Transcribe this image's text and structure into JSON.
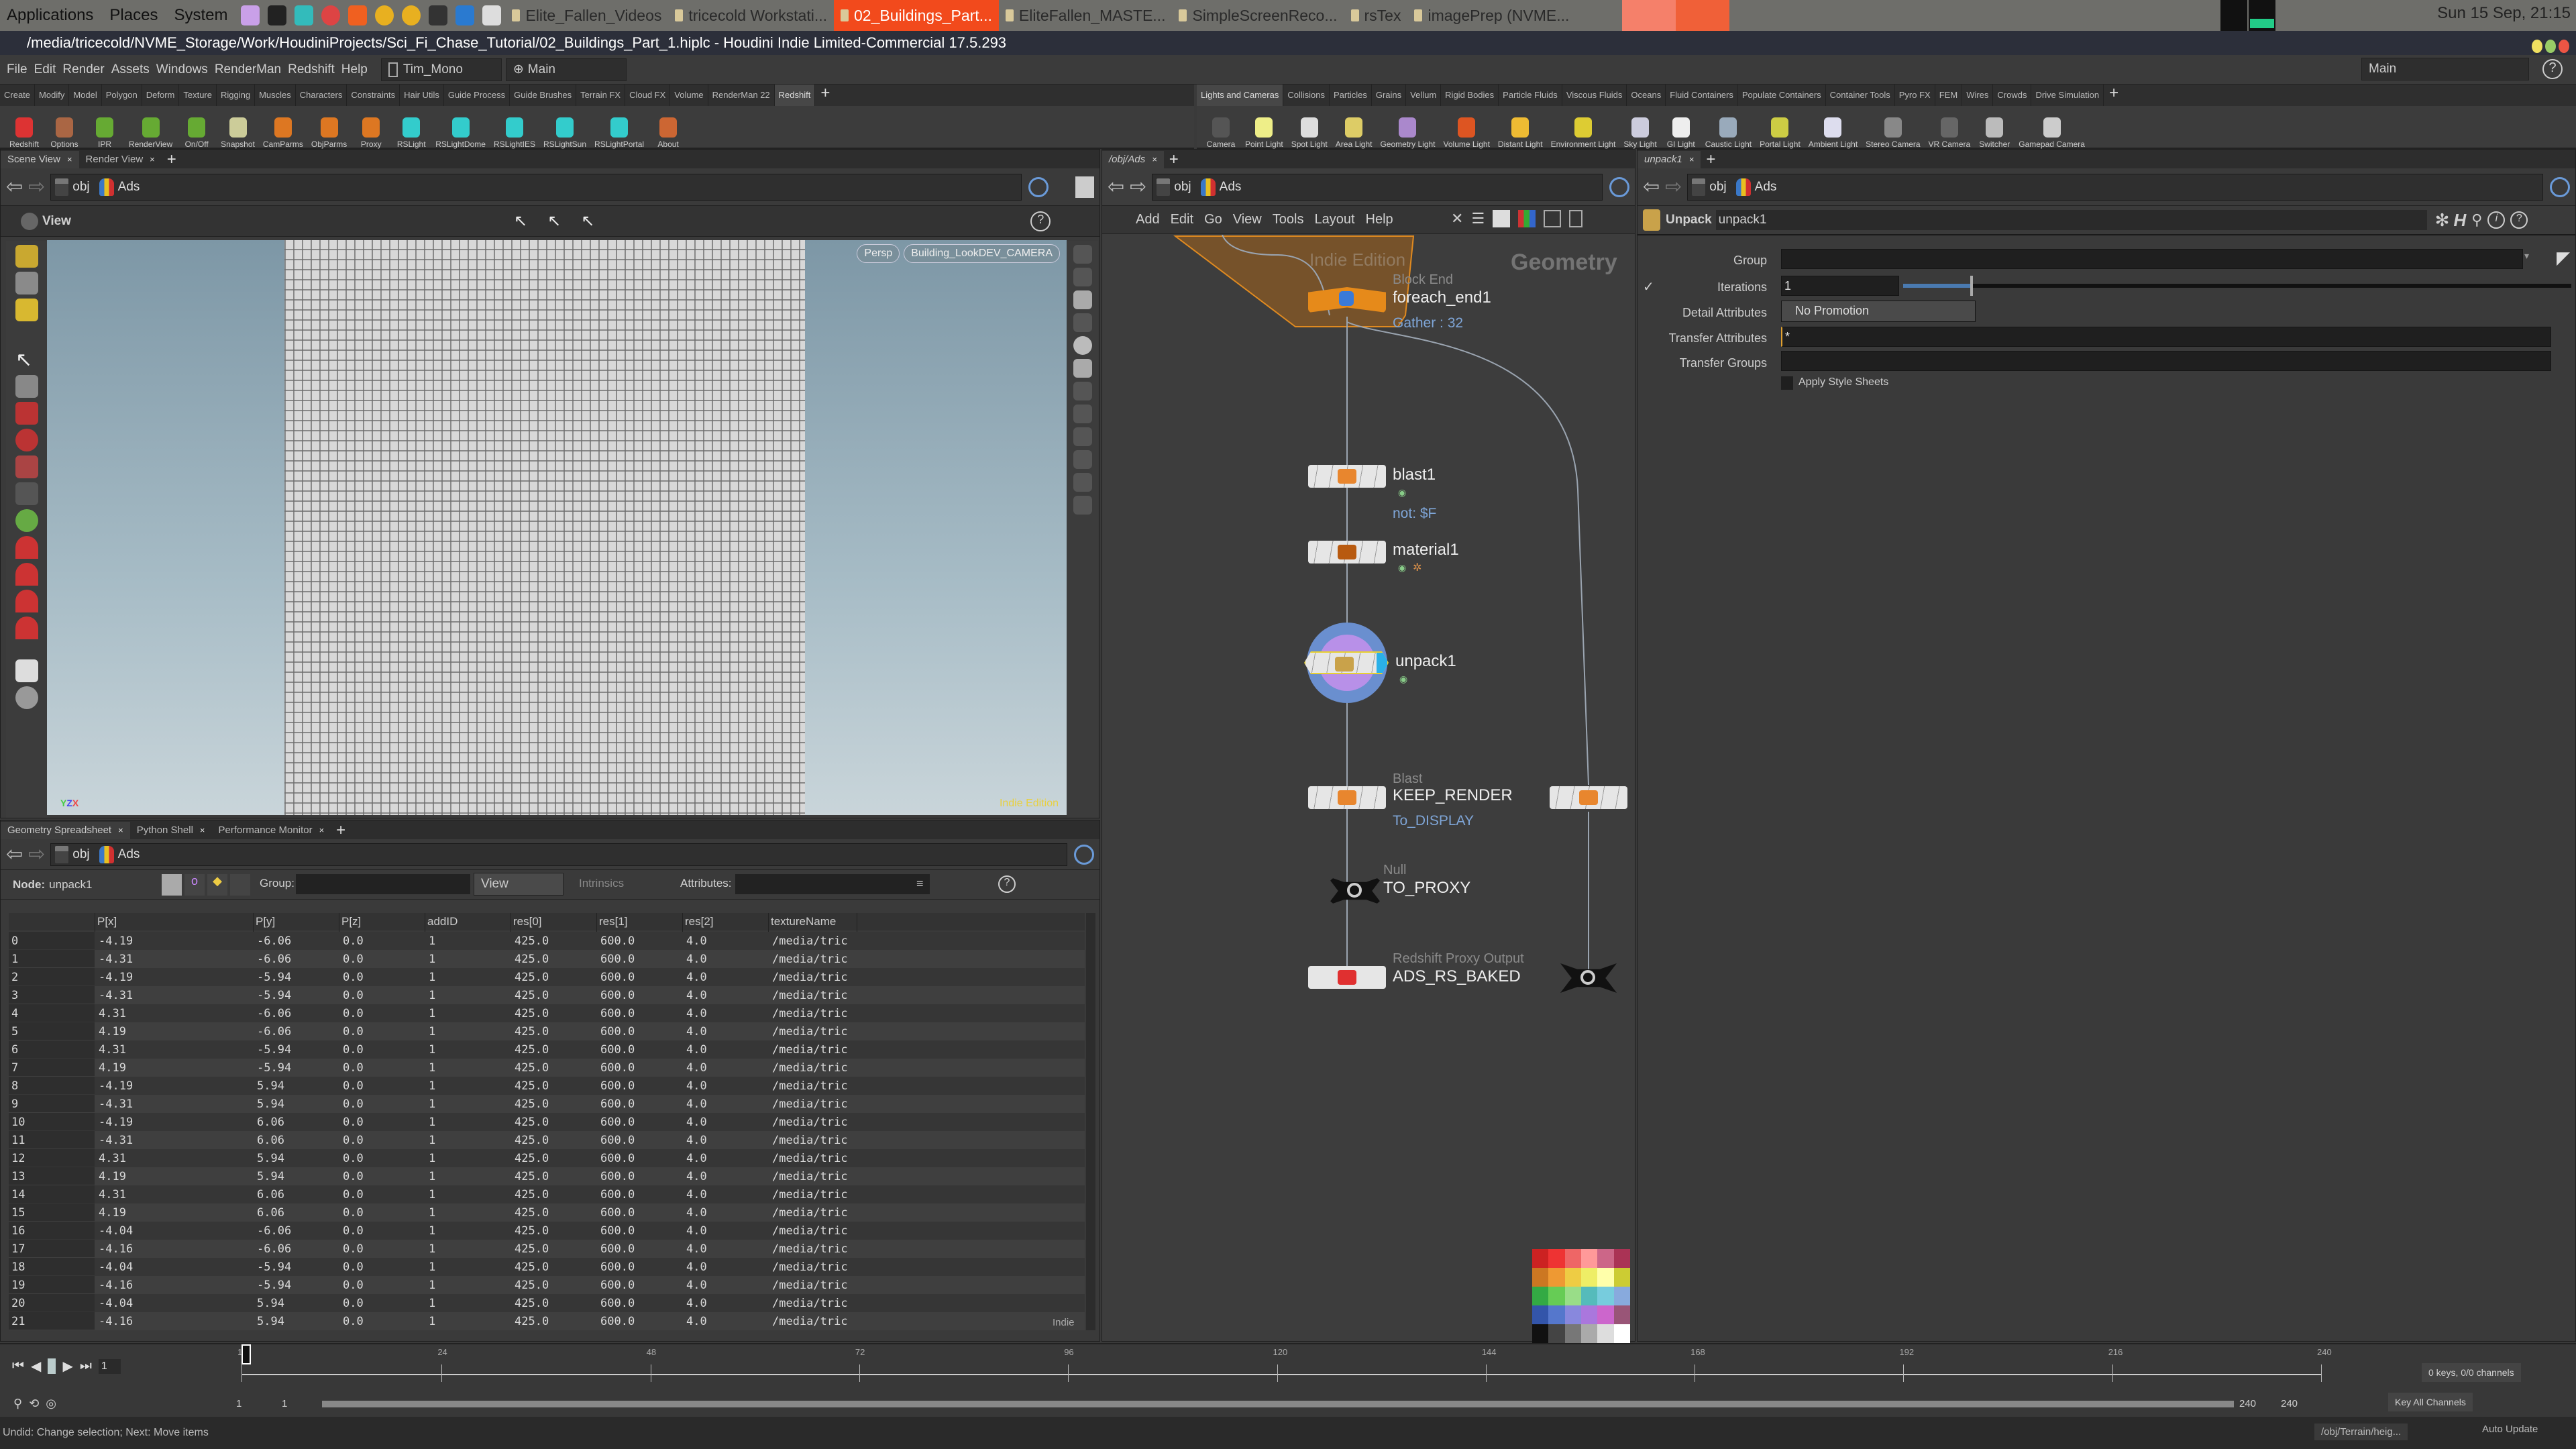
{
  "os": {
    "menus": [
      "Applications",
      "Places",
      "System"
    ],
    "tasks": [
      {
        "label": "Elite_Fallen_Videos",
        "active": false
      },
      {
        "label": "tricecold Workstati...",
        "active": false
      },
      {
        "label": "02_Buildings_Part...",
        "active": true
      },
      {
        "label": "EliteFallen_MASTE...",
        "active": false
      },
      {
        "label": "SimpleScreenReco...",
        "active": false
      },
      {
        "label": "rsTex",
        "active": false
      },
      {
        "label": "imagePrep (NVME...",
        "active": false
      }
    ],
    "clock": "Sun 15 Sep, 21:15"
  },
  "window": {
    "title": "/media/tricecold/NVME_Storage/Work/HoudiniProjects/Sci_Fi_Chase_Tutorial/02_Buildings_Part_1.hiplc - Houdini Indie Limited-Commercial 17.5.293"
  },
  "menubar": {
    "items": [
      "File",
      "Edit",
      "Render",
      "Assets",
      "Windows",
      "RenderMan",
      "Redshift",
      "Help"
    ],
    "desktop": "Tim_Mono",
    "context": "Main",
    "right_context": "Main"
  },
  "shelf_left": {
    "tabs": [
      "Create",
      "Modify",
      "Model",
      "Polygon",
      "Deform",
      "Texture",
      "Rigging",
      "Muscles",
      "Characters",
      "Constraints",
      "Hair Utils",
      "Guide Process",
      "Guide Brushes",
      "Terrain FX",
      "Cloud FX",
      "Volume",
      "RenderMan 22",
      "Redshift"
    ],
    "active_tab": "Redshift",
    "tools": [
      "Redshift",
      "Options",
      "IPR",
      "RenderView",
      "On/Off",
      "Snapshot",
      "CamParms",
      "ObjParms",
      "Proxy",
      "RSLight",
      "RSLightDome",
      "RSLightIES",
      "RSLightSun",
      "RSLightPortal",
      "About"
    ]
  },
  "shelf_right": {
    "tabs": [
      "Lights and Cameras",
      "Collisions",
      "Particles",
      "Grains",
      "Vellum",
      "Rigid Bodies",
      "Particle Fluids",
      "Viscous Fluids",
      "Oceans",
      "Fluid Containers",
      "Populate Containers",
      "Container Tools",
      "Pyro FX",
      "FEM",
      "Wires",
      "Crowds",
      "Drive Simulation"
    ],
    "active_tab": "Lights and Cameras",
    "tools": [
      "Camera",
      "Point Light",
      "Spot Light",
      "Area Light",
      "Geometry Light",
      "Volume Light",
      "Distant Light",
      "Environment Light",
      "Sky Light",
      "GI Light",
      "Caustic Light",
      "Portal Light",
      "Ambient Light",
      "Stereo Camera",
      "VR Camera",
      "Switcher",
      "Gamepad Camera"
    ]
  },
  "scene": {
    "tabs": [
      "Scene View",
      "Render View"
    ],
    "path": [
      "obj",
      "Ads"
    ],
    "toolbar_label": "View",
    "persp": "Persp",
    "camera": "Building_LookDEV_CAMERA",
    "watermark": "Indie Edition"
  },
  "spreadsheet": {
    "tabs": [
      "Geometry Spreadsheet",
      "Python Shell",
      "Performance Monitor"
    ],
    "path": [
      "obj",
      "Ads"
    ],
    "node_label": "Node:",
    "node": "unpack1",
    "group_label": "Group:",
    "view_label": "View",
    "intrinsics_label": "Intrinsics",
    "attributes_label": "Attributes:",
    "indie": "Indie",
    "columns": [
      "",
      "P[x]",
      "P[y]",
      "P[z]",
      "addID",
      "res[0]",
      "res[1]",
      "res[2]",
      "textureName"
    ],
    "rows": [
      [
        "0",
        "-4.19",
        "-6.06",
        "0.0",
        "1",
        "425.0",
        "600.0",
        "4.0",
        "/media/tric"
      ],
      [
        "1",
        "-4.31",
        "-6.06",
        "0.0",
        "1",
        "425.0",
        "600.0",
        "4.0",
        "/media/tric"
      ],
      [
        "2",
        "-4.19",
        "-5.94",
        "0.0",
        "1",
        "425.0",
        "600.0",
        "4.0",
        "/media/tric"
      ],
      [
        "3",
        "-4.31",
        "-5.94",
        "0.0",
        "1",
        "425.0",
        "600.0",
        "4.0",
        "/media/tric"
      ],
      [
        "4",
        "4.31",
        "-6.06",
        "0.0",
        "1",
        "425.0",
        "600.0",
        "4.0",
        "/media/tric"
      ],
      [
        "5",
        "4.19",
        "-6.06",
        "0.0",
        "1",
        "425.0",
        "600.0",
        "4.0",
        "/media/tric"
      ],
      [
        "6",
        "4.31",
        "-5.94",
        "0.0",
        "1",
        "425.0",
        "600.0",
        "4.0",
        "/media/tric"
      ],
      [
        "7",
        "4.19",
        "-5.94",
        "0.0",
        "1",
        "425.0",
        "600.0",
        "4.0",
        "/media/tric"
      ],
      [
        "8",
        "-4.19",
        "5.94",
        "0.0",
        "1",
        "425.0",
        "600.0",
        "4.0",
        "/media/tric"
      ],
      [
        "9",
        "-4.31",
        "5.94",
        "0.0",
        "1",
        "425.0",
        "600.0",
        "4.0",
        "/media/tric"
      ],
      [
        "10",
        "-4.19",
        "6.06",
        "0.0",
        "1",
        "425.0",
        "600.0",
        "4.0",
        "/media/tric"
      ],
      [
        "11",
        "-4.31",
        "6.06",
        "0.0",
        "1",
        "425.0",
        "600.0",
        "4.0",
        "/media/tric"
      ],
      [
        "12",
        "4.31",
        "5.94",
        "0.0",
        "1",
        "425.0",
        "600.0",
        "4.0",
        "/media/tric"
      ],
      [
        "13",
        "4.19",
        "5.94",
        "0.0",
        "1",
        "425.0",
        "600.0",
        "4.0",
        "/media/tric"
      ],
      [
        "14",
        "4.31",
        "6.06",
        "0.0",
        "1",
        "425.0",
        "600.0",
        "4.0",
        "/media/tric"
      ],
      [
        "15",
        "4.19",
        "6.06",
        "0.0",
        "1",
        "425.0",
        "600.0",
        "4.0",
        "/media/tric"
      ],
      [
        "16",
        "-4.04",
        "-6.06",
        "0.0",
        "1",
        "425.0",
        "600.0",
        "4.0",
        "/media/tric"
      ],
      [
        "17",
        "-4.16",
        "-6.06",
        "0.0",
        "1",
        "425.0",
        "600.0",
        "4.0",
        "/media/tric"
      ],
      [
        "18",
        "-4.04",
        "-5.94",
        "0.0",
        "1",
        "425.0",
        "600.0",
        "4.0",
        "/media/tric"
      ],
      [
        "19",
        "-4.16",
        "-5.94",
        "0.0",
        "1",
        "425.0",
        "600.0",
        "4.0",
        "/media/tric"
      ],
      [
        "20",
        "-4.04",
        "5.94",
        "0.0",
        "1",
        "425.0",
        "600.0",
        "4.0",
        "/media/tric"
      ],
      [
        "21",
        "-4.16",
        "5.94",
        "0.0",
        "1",
        "425.0",
        "600.0",
        "4.0",
        "/media/tric"
      ]
    ]
  },
  "network": {
    "tab": "/obj/Ads",
    "path": [
      "obj",
      "Ads"
    ],
    "menu": [
      "Add",
      "Edit",
      "Go",
      "View",
      "Tools",
      "Layout",
      "Help"
    ],
    "watermark": "Indie Edition",
    "context_label": "Geometry",
    "nodes": [
      {
        "name": "foreach_end1",
        "type": "Block End",
        "comment": "Gather : 32"
      },
      {
        "name": "blast1",
        "type": "",
        "comment": "not: $F"
      },
      {
        "name": "material1",
        "type": "",
        "comment": ""
      },
      {
        "name": "unpack1",
        "type": "",
        "comment": ""
      },
      {
        "name": "KEEP_RENDER",
        "type": "Blast",
        "comment": "To_DISPLAY"
      },
      {
        "name": "TO_PROXY",
        "type": "Null",
        "comment": ""
      },
      {
        "name": "ADS_RS_BAKED",
        "type": "Redshift Proxy Output",
        "comment": ""
      }
    ]
  },
  "params": {
    "tab": "unpack1",
    "path": [
      "obj",
      "Ads"
    ],
    "node_type": "Unpack",
    "node_name": "unpack1",
    "fields": {
      "group_label": "Group",
      "group_value": "",
      "iterations_label": "Iterations",
      "iterations_value": "1",
      "detail_label": "Detail Attributes",
      "detail_value": "No Promotion",
      "transfer_attr_label": "Transfer Attributes",
      "transfer_attr_value": "*",
      "transfer_groups_label": "Transfer Groups",
      "transfer_groups_value": "",
      "style_label": "Apply Style Sheets"
    },
    "iterations_slider_fraction": 0.1
  },
  "timeline": {
    "ticks": [
      "1",
      "24",
      "48",
      "72",
      "96",
      "120",
      "144",
      "168",
      "192",
      "216",
      "240"
    ],
    "current_frame": "1",
    "range_start": "1",
    "range_start2": "1",
    "range_end": "240",
    "range_end2": "240",
    "keys": "0 keys, 0/0 channels",
    "key_all": "Key All Channels"
  },
  "status": {
    "message": "Undid: Change selection; Next: Move items",
    "path": "/obj/Terrain/heig...",
    "update": "Auto Update"
  },
  "colors": {
    "accent": "#f24a1c",
    "foreach": "#e68a1a",
    "comment": "#7fa6d8",
    "panel": "#3a3a3a"
  }
}
